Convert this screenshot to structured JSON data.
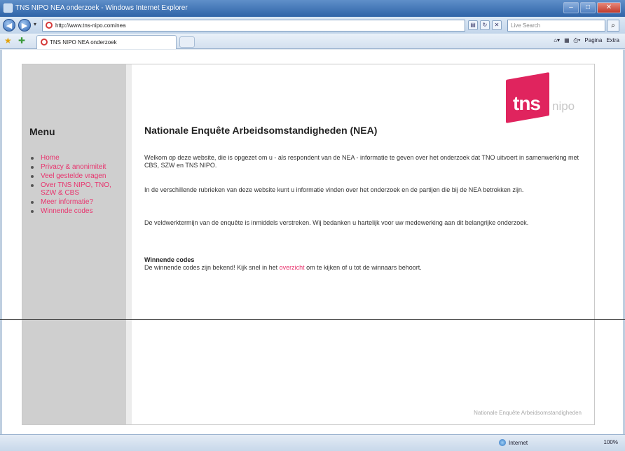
{
  "window": {
    "title": "TNS NIPO NEA onderzoek - Windows Internet Explorer"
  },
  "address_bar": {
    "url": "http://www.tns-nipo.com/nea",
    "search_placeholder": "Live Search"
  },
  "tab": {
    "label": "TNS NIPO NEA onderzoek"
  },
  "command_bar": {
    "items": [
      "Pagina",
      "Extra"
    ]
  },
  "logo": {
    "mark": "tns",
    "suffix": "nipo",
    "brand_color": "#e0245e"
  },
  "sidebar": {
    "title": "Menu",
    "items": [
      "Home",
      "Privacy & anonimiteit",
      "Veel gestelde vragen",
      "Over TNS NIPO, TNO, SZW & CBS",
      "Meer informatie?",
      "Winnende codes"
    ],
    "link_color": "#e8336d"
  },
  "main": {
    "title": "Nationale Enquête Arbeidsomstandigheden (NEA)",
    "paragraphs": [
      "Welkom op deze website, die is opgezet om u - als respondent van de NEA - informatie te geven over het onderzoek dat TNO uitvoert in samenwerking met CBS, SZW en TNS NIPO.",
      "In de verschillende rubrieken van deze website kunt u informatie vinden over het onderzoek en de partijen die bij de NEA betrokken zijn.",
      "De veldwerktermijn van de enquête is inmiddels verstreken. Wij bedanken u hartelijk voor uw medewerking aan dit belangrijke onderzoek."
    ],
    "winners": {
      "title": "Winnende codes",
      "text_before": "De winnende codes zijn bekend! Kijk snel in het",
      "link": "overzicht",
      "text_after": "om te kijken of u tot de winnaars behoort."
    },
    "footer": "Nationale Enquête Arbeidsomstandigheden"
  },
  "status_bar": {
    "zone": "Internet",
    "zoom": "100%"
  }
}
